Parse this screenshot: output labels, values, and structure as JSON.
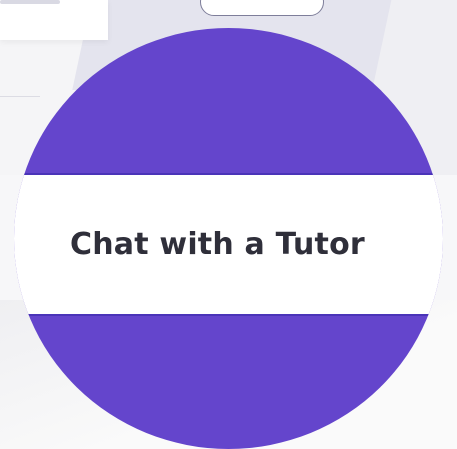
{
  "tutor_button": {
    "label": "Chat with a Tutor"
  },
  "colors": {
    "accent": "#6445cc",
    "button_bg": "#ffffff",
    "button_text": "#2f2f3a",
    "page_bg": "#f3f3f6"
  }
}
